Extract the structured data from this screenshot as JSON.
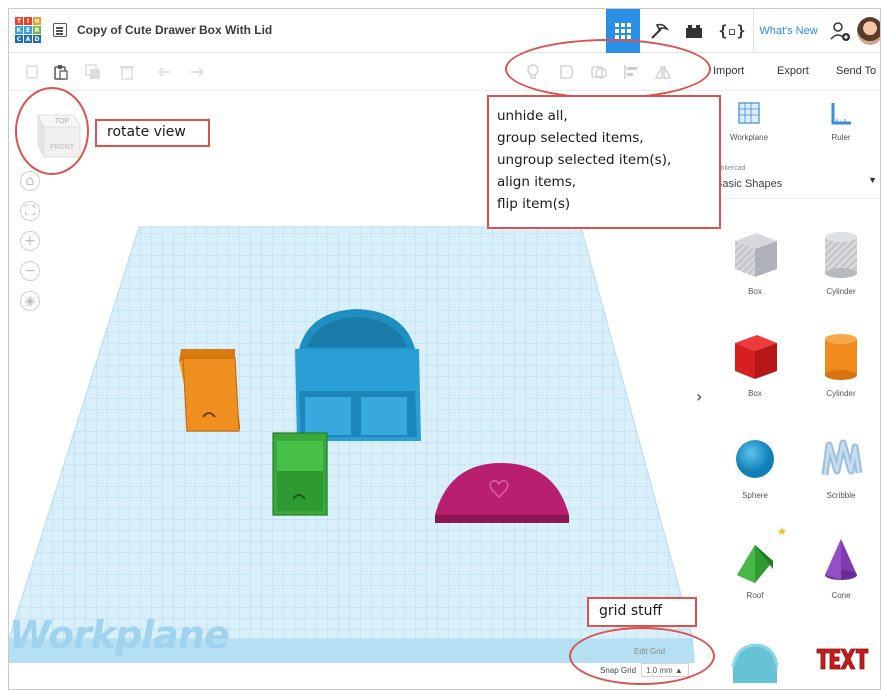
{
  "app": {
    "logo_letters": [
      "T",
      "I",
      "N",
      "K",
      "E",
      "R",
      "C",
      "A",
      "D"
    ],
    "document_title": "Copy of Cute Drawer Box With Lid"
  },
  "header": {
    "whats_new": "What's New",
    "active_view_icon": "grid-view-icon"
  },
  "toolbar": {
    "import": "Import",
    "export": "Export",
    "send_to": "Send To"
  },
  "viewcube": {
    "top": "TOP",
    "front": "FRONT"
  },
  "workplane": {
    "label": "Workplane",
    "edit_grid": "Edit Grid",
    "snap_grid_label": "Snap Grid",
    "snap_grid_value": "1.0 mm ▲"
  },
  "panel": {
    "workplane_tool": "Workplane",
    "ruler_tool": "Ruler",
    "library_small": "Tinkercad",
    "library_name": "Basic Shapes",
    "shapes": [
      {
        "name": "Box",
        "color": "#b9bdc3"
      },
      {
        "name": "Cylinder",
        "color": "#c3c6ca"
      },
      {
        "name": "Box",
        "color": "#d62020"
      },
      {
        "name": "Cylinder",
        "color": "#f08a1c"
      },
      {
        "name": "Sphere",
        "color": "#1c9bd6"
      },
      {
        "name": "Scribble",
        "color": "#8fb4d6"
      },
      {
        "name": "Roof",
        "color": "#3aaa3a"
      },
      {
        "name": "Cone",
        "color": "#7f3db0"
      }
    ]
  },
  "annotations": {
    "rotate_view": "rotate view",
    "toolbar_note": [
      "unhide all,",
      "group selected items,",
      "ungroup selected item(s),",
      "align items,",
      "flip item(s)"
    ],
    "grid_stuff": "grid stuff"
  },
  "colors": {
    "accent": "#2b8fe6",
    "annotation": "#d9534f",
    "grid": "#bfe3f5"
  }
}
